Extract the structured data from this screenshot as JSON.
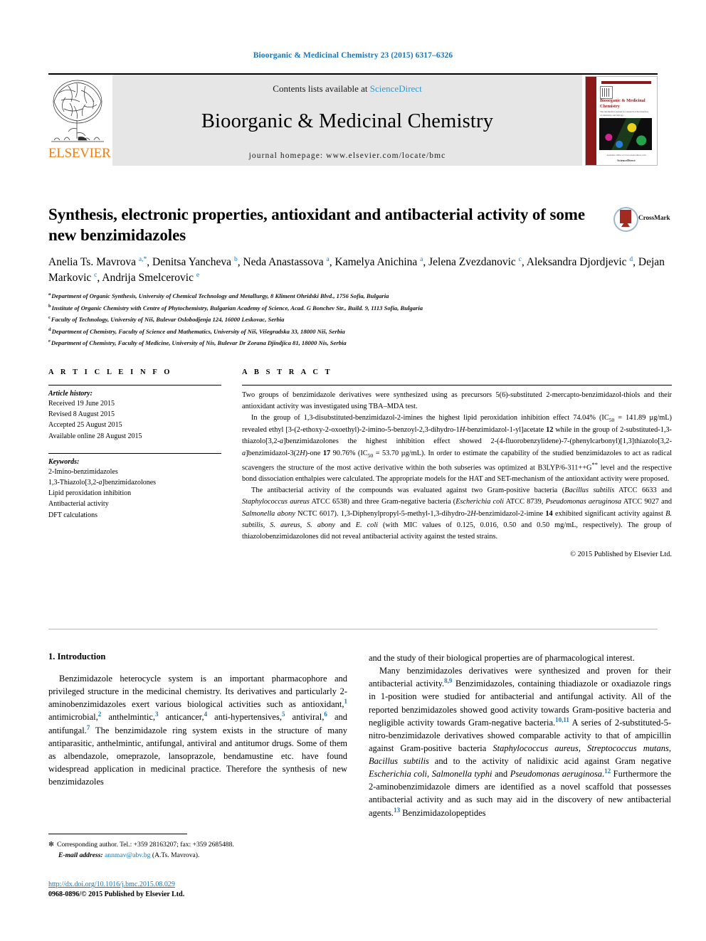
{
  "running_head": "Bioorganic & Medicinal Chemistry 23 (2015) 6317–6326",
  "masthead": {
    "contents_prefix": "Contents lists available at ",
    "sciencedirect": "ScienceDirect",
    "journal_title": "Bioorganic & Medicinal Chemistry",
    "homepage": "journal homepage: www.elsevier.com/locate/bmc",
    "publisher_wordmark": "ELSEVIER",
    "cover": {
      "journal_title": "Bioorganic & Medicinal Chemistry",
      "subtitle": "The tetrahedron journal for research at the interface of chemistry and biology",
      "footer_note": "Available online at www.sciencedirect.com",
      "footer_brand": "ScienceDirect"
    }
  },
  "article": {
    "title": "Synthesis, electronic properties, antioxidant and antibacterial activity of some new benzimidazoles",
    "crossmark_label": "CrossMark",
    "authors_html": "Anelia Ts. Mavrova <sup>a,*</sup>, Denitsa Yancheva <sup>b</sup>, Neda Anastassova <sup>a</sup>, Kamelya Anichina <sup>a</sup>, Jelena Zvezdanovic <sup>c</sup>, Aleksandra Djordjevic <sup>d</sup>, Dejan Markovic <sup>c</sup>, Andrija Smelcerovic <sup>e</sup>",
    "affiliations": [
      {
        "label": "a",
        "text": "Department of Organic Synthesis, University of Chemical Technology and Metallurgy, 8 Kliment Ohridski Blvd., 1756 Sofia, Bulgaria"
      },
      {
        "label": "b",
        "text": "Institute of Organic Chemistry with Centre of Phytochemistry, Bulgarian Academy of Science, Acad. G Bonchev Str., Build. 9, 1113 Sofia, Bulgaria"
      },
      {
        "label": "c",
        "text": "Faculty of Technology, University of Niš, Bulevar Oslobodjenja 124, 16000 Leskovac, Serbia"
      },
      {
        "label": "d",
        "text": "Department of Chemistry, Faculty of Science and Mathematics, University of Niš, Višegradska 33, 18000 Niš, Serbia"
      },
      {
        "label": "e",
        "text": "Department of Chemistry, Faculty of Medicine, University of Nis, Bulevar Dr Zorana Djindjica 81, 18000 Nis, Serbia"
      }
    ]
  },
  "article_info": {
    "heading": "A R T I C L E   I N F O",
    "history_label": "Article history:",
    "history": [
      "Received 19 June 2015",
      "Revised 8 August 2015",
      "Accepted 25 August 2015",
      "Available online 28 August 2015"
    ],
    "keywords_label": "Keywords:",
    "keywords_html": [
      "2-Imino-benzimidazoles",
      "1,3-Thiazolo[3,2-<i>a</i>]benzimidazolones",
      "Lipid peroxidation inhibition",
      "Antibacterial activity",
      "DFT calculations"
    ]
  },
  "abstract": {
    "heading": "A B S T R A C T",
    "paragraphs_html": [
      "Two groups of benzimidazole derivatives were synthesized using as precursors 5(6)-substituted 2-mercapto-benzimidazol-thiols and their antioxidant activity was investigated using TBA&ndash;MDA test.",
      "In the group of 1,3-disubstituted-benzimidazol-2-imines the highest lipid peroxidation inhibition effect 74.04% (IC<sub>50</sub> = 141.89 &micro;g/mL) revealed ethyl [3-(2-ethoxy-2-oxoethyl)-2-imino-5-benzoyl-2,3-dihydro-1<i>H</i>-benzimidazol-1-yl]acetate <b>12</b> while in the group of 2-substituted-1,3-thiazolo[3,2-<i>a</i>]benzimidazolones the highest inhibition effect showed 2-(4-fluorobenzylidene)-7-(phenylcarbonyl)[1,3]thiazolo[3,2-<i>a</i>]benzimidazol-3(2<i>H</i>)-one <b>17</b> 90.76% (IC<sub>50</sub> = 53.70 &micro;g/mL). In order to estimate the capability of the studied benzimidazoles to act as radical scavengers the structure of the most active derivative within the both subseries was optimized at B3LYP/6-311++G<sup>**</sup> level and the respective bond dissociation enthalpies were calculated. The appropriate models for the HAT and SET-mechanism of the antioxidant activity were proposed.",
      "The antibacterial activity of the compounds was evaluated against two Gram-positive bacteria (<i>Bacillus subtilis</i> ATCC 6633 and <i>Staphylococcus aureus</i> ATCC 6538) and three Gram-negative bacteria (<i>Escherichia coli</i> ATCC 8739, <i>Pseudomonas aeruginosa</i> ATCC 9027 and <i>Salmonella abony</i> NCTC 6017). 1,3-Diphenylpropyl-5-methyl-1,3-dihydro-2<i>H</i>-benzimidazol-2-imine <b>14</b> exhibited significant activity against <i>B. subtilis</i>, <i>S. aureus</i>, <i>S. abony</i> and <i>E. coli</i> (with MIC values of 0.125, 0.016, 0.50 and 0.50 mg/mL, respectively). The group of thiazolobenzimidazolones did not reveal antibacterial activity against the tested strains."
    ],
    "copyright": "© 2015 Published by Elsevier Ltd."
  },
  "introduction": {
    "heading": "1. Introduction",
    "left_paragraph_html": "Benzimidazole heterocycle system is an important pharmacophore and privileged structure in the medicinal chemistry. Its derivatives and particularly 2-aminobenzimidazoles exert various biological activities such as antioxidant,<sup>1</sup> antimicrobial,<sup>2</sup> anthelmintic,<sup>3</sup> anticancer,<sup>4</sup> anti-hypertensives,<sup>5</sup> antiviral,<sup>6</sup> and antifungal.<sup>7</sup> The benzimidazole ring system exists in the structure of many antiparasitic, anthelmintic, antifungal, antiviral and antitumor drugs. Some of them as albendazole, omeprazole, lansoprazole, bendamustine etc. have found widespread application in medicinal practice. Therefore the synthesis of new benzimidazoles",
    "right_paragraph_1_html": "and the study of their biological properties are of pharmacological interest.",
    "right_paragraph_2_html": "Many benzimidazoles derivatives were synthesized and proven for their antibacterial activity.<sup>8,9</sup> Benzimidazoles, containing thiadiazole or oxadiazole rings in 1-position were studied for antibacterial and antifungal activity. All of the reported benzimidazoles showed good activity towards Gram-positive bacteria and negligible activity towards Gram-negative bacteria.<sup>10,11</sup> A series of 2-substituted-5-nitro-benzimidazole derivatives showed comparable activity to that of ampicillin against Gram-positive bacteria <i>Staphylococcus aureus</i>, <i>Streptococcus mutans</i>, <i>Bacillus subtilis</i> and to the activity of nalidixic acid against Gram negative <i>Escherichia coli</i>, <i>Salmonella typhi</i> and <i>Pseudomonas aeruginosa</i>.<sup>12</sup> Furthermore the 2-aminobenzimidazole dimers are identified as a novel scaffold that possesses antibacterial activity and as such may aid in the discovery of new antibacterial agents.<sup>13</sup> Benzimidazolopeptides"
  },
  "footnote": {
    "star": "✻",
    "corresponding_html": "Corresponding author. Tel.: +359 28163207; fax: +359 2685488.",
    "email_label": "E-mail address:",
    "email": "annmav@abv.bg",
    "email_owner": "(A.Ts. Mavrova)."
  },
  "imprint": {
    "doi": "http://dx.doi.org/10.1016/j.bmc.2015.08.029",
    "issn_line": "0968-0896/© 2015 Published by Elsevier Ltd."
  },
  "colors": {
    "accent_blue": "#1b75bb",
    "sciencedirect_blue": "#2d9bd1",
    "elsevier_orange": "#f07f13",
    "banner_gray": "#e6e6e6",
    "crossmark_red": "#a32a21"
  }
}
